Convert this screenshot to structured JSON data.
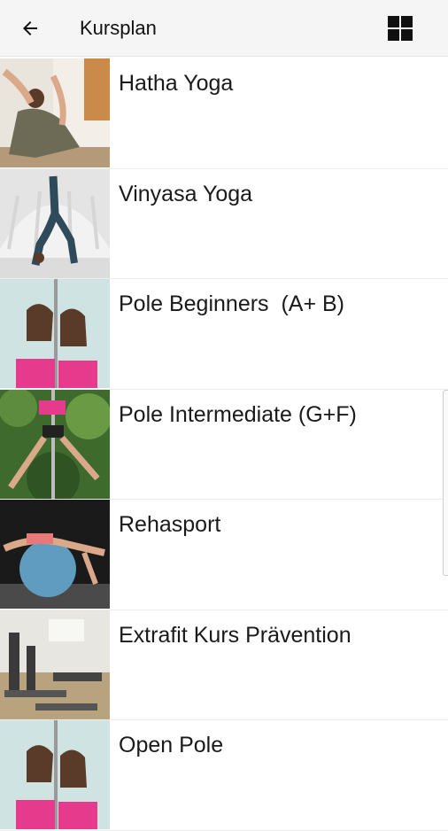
{
  "header": {
    "title": "Kursplan",
    "back_icon": "arrow-left-icon",
    "view_icon": "grid-view-icon"
  },
  "courses": [
    {
      "label": "Hatha Yoga",
      "thumb": "yoga-pose-photo"
    },
    {
      "label": "Vinyasa Yoga",
      "thumb": "backbend-pose-photo"
    },
    {
      "label": "Pole Beginners  (A+ B)",
      "thumb": "pole-dancers-photo"
    },
    {
      "label": "Pole Intermediate (G+F)",
      "thumb": "pole-split-photo"
    },
    {
      "label": "Rehasport",
      "thumb": "gym-ball-photo"
    },
    {
      "label": "Extrafit Kurs Prävention",
      "thumb": "pilates-studio-photo"
    },
    {
      "label": "Open Pole",
      "thumb": "pole-dancers-photo"
    }
  ],
  "colors": {
    "appbar_bg": "#f5f5f5",
    "text": "#1a1a1a"
  }
}
